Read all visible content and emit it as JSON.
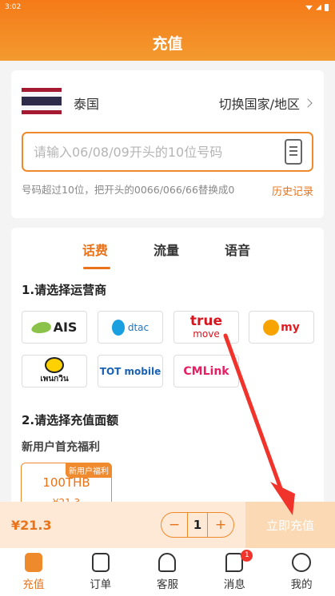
{
  "status_bar": {
    "time": "3:02"
  },
  "header": {
    "title": "充值"
  },
  "country": {
    "name": "泰国",
    "switch_label": "切换国家/地区"
  },
  "phone": {
    "placeholder": "请输入06/08/09开头的10位号码",
    "value": ""
  },
  "hint_text": "号码超过10位，把开头的0066/066/66替换成0",
  "history_label": "历史记录",
  "tabs": [
    {
      "label": "话费",
      "active": true
    },
    {
      "label": "流量",
      "active": false
    },
    {
      "label": "语音",
      "active": false
    }
  ],
  "section_operator": "1.请选择运营商",
  "operators": [
    {
      "name": "AIS",
      "icon": "ais-logo"
    },
    {
      "name": "dtac",
      "icon": "dtac-logo"
    },
    {
      "name": "true",
      "sub": "move",
      "icon": "truemove-logo"
    },
    {
      "name": "my",
      "icon": "my-logo"
    },
    {
      "name": "เพนกวิน",
      "icon": "penguin-logo"
    },
    {
      "name": "TOT mobile",
      "icon": "tot-logo"
    },
    {
      "name": "CMLink",
      "icon": "cmlink-logo"
    }
  ],
  "section_amount": "2.请选择充值面额",
  "new_user_title": "新用户首充福利",
  "package": {
    "badge": "新用户福利",
    "amount": "100THB",
    "price": "¥21.3"
  },
  "paybar": {
    "total": "¥21.3",
    "quantity": "1",
    "minus": "−",
    "plus": "+",
    "pay_label": "立即充值"
  },
  "tabbar": [
    {
      "label": "充值",
      "icon": "recharge-icon",
      "active": true
    },
    {
      "label": "订单",
      "icon": "order-icon"
    },
    {
      "label": "客服",
      "icon": "headset-icon"
    },
    {
      "label": "消息",
      "icon": "message-icon",
      "badge": "1"
    },
    {
      "label": "我的",
      "icon": "smile-icon"
    }
  ],
  "colors": {
    "accent": "#e8731a",
    "header_start": "#f57a18",
    "header_end": "#f39a2e",
    "arrow": "#f0342c"
  }
}
